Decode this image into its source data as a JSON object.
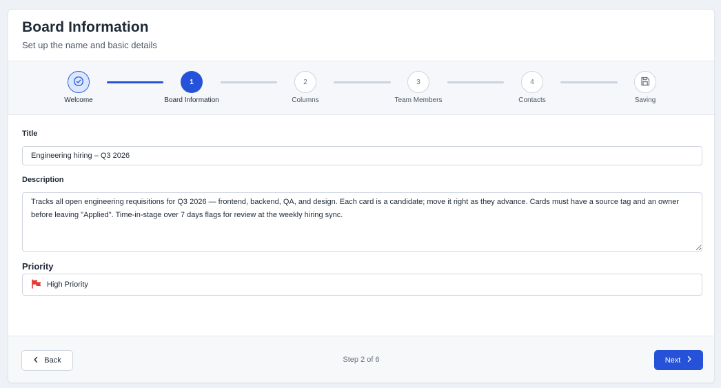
{
  "header": {
    "title": "Board Information",
    "subtitle": "Set up the name and basic details"
  },
  "stepper": {
    "steps": [
      {
        "label": "Welcome",
        "marker": "",
        "state": "done",
        "icon": "check-circle-icon"
      },
      {
        "label": "Board Information",
        "marker": "1",
        "state": "active"
      },
      {
        "label": "Columns",
        "marker": "2",
        "state": "upcoming"
      },
      {
        "label": "Team Members",
        "marker": "3",
        "state": "upcoming"
      },
      {
        "label": "Contacts",
        "marker": "4",
        "state": "upcoming"
      },
      {
        "label": "Saving",
        "marker": "",
        "state": "upcoming",
        "icon": "save-icon"
      }
    ]
  },
  "form": {
    "title": {
      "label": "Title",
      "value": "Engineering hiring – Q3 2026"
    },
    "description": {
      "label": "Description",
      "value": "Tracks all open engineering requisitions for Q3 2026 — frontend, backend, QA, and design. Each card is a candidate; move it right as they advance. Cards must have a source tag and an owner before leaving \"Applied\". Time-in-stage over 7 days flags for review at the weekly hiring sync."
    },
    "priority": {
      "label": "Priority",
      "value": "High Priority",
      "icon": "flag-icon",
      "color": "#e53935"
    }
  },
  "footer": {
    "back_label": "Back",
    "next_label": "Next",
    "step_text": "Step 2 of 6"
  },
  "colors": {
    "accent": "#2552d8",
    "page_bg": "#eef1f6",
    "connector_upcoming": "#cbd3de"
  }
}
